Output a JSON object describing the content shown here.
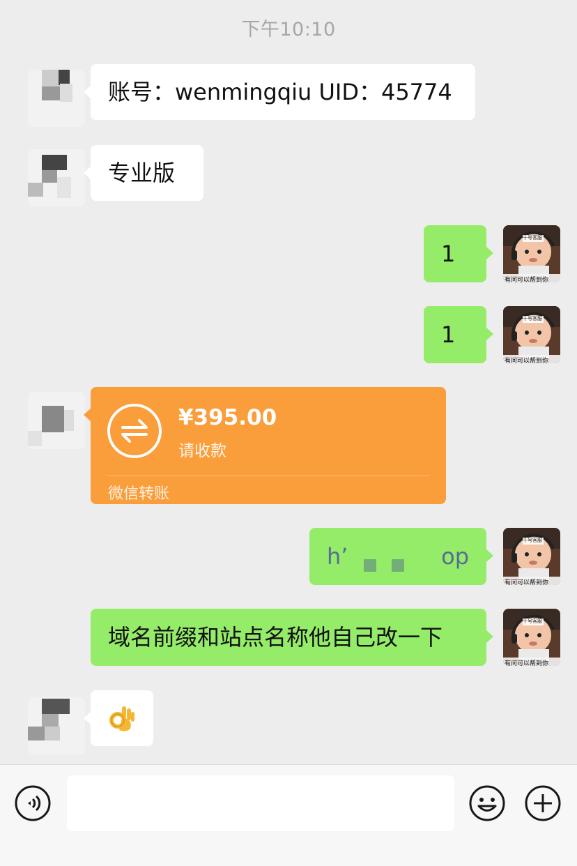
{
  "timestamp": "下午10:10",
  "messages": [
    {
      "side": "left",
      "type": "text",
      "text": "账号：wenmingqiu   UID：45774"
    },
    {
      "side": "left",
      "type": "text",
      "text": "专业版"
    },
    {
      "side": "right",
      "type": "text",
      "text": "1"
    },
    {
      "side": "right",
      "type": "text",
      "text": "1"
    },
    {
      "side": "left",
      "type": "transfer",
      "amount": "¥395.00",
      "note": "请收款",
      "footer": "微信转账"
    },
    {
      "side": "right",
      "type": "text",
      "text_start": "h’",
      "text_end": "op"
    },
    {
      "side": "right",
      "type": "text",
      "text": "域名前缀和站点名称他自己改一下"
    },
    {
      "side": "left",
      "type": "emoji",
      "icon": "ok-hand-icon",
      "text": "👌"
    }
  ],
  "self_avatar": {
    "badge": "十号客服",
    "caption": "有问可以帮到你"
  },
  "toolbar": {
    "voice_icon": "voice-icon",
    "emoji_icon": "smiley-icon",
    "more_icon": "plus-circle-icon"
  },
  "colors": {
    "background": "#ededed",
    "self_bubble": "#95ec69",
    "other_bubble": "#ffffff",
    "transfer": "#fa9d3b"
  }
}
